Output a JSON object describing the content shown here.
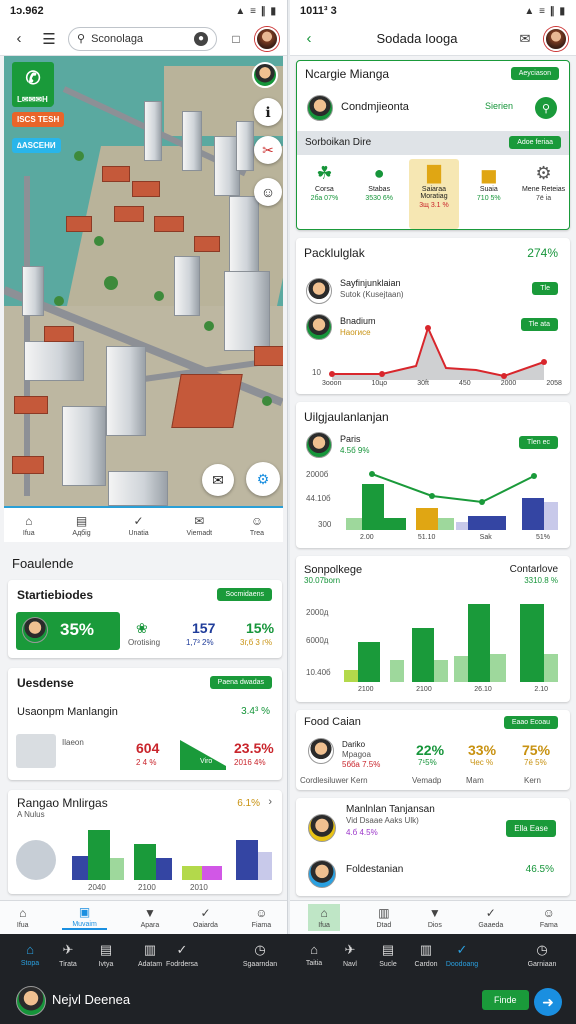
{
  "left": {
    "status": {
      "time": "1ɔ.962",
      "icons": "▲ ≡ ∥ ▮"
    },
    "search": {
      "placeholder": "Sconolaga"
    },
    "map": {
      "chip1": "L✉✉✉H",
      "chip2": "ISCS TESH",
      "chip3": "∆ASCEHИ",
      "tabs": [
        {
          "icon": "home-icon",
          "glyph": "⌂",
          "label": "Ifua"
        },
        {
          "icon": "grid-icon",
          "glyph": "▤",
          "label": "Aдбig"
        },
        {
          "icon": "check-icon",
          "glyph": "✓",
          "label": "Unatia"
        },
        {
          "icon": "chat-icon",
          "glyph": "✉",
          "label": "Viemadt"
        },
        {
          "icon": "person-icon",
          "glyph": "☺",
          "label": "Trea"
        }
      ]
    },
    "section_title": "Foaulende",
    "card1": {
      "title": "Startiebiodes",
      "btn": "Socmidaens",
      "pct": "35%",
      "item2": "Orotising",
      "v1": "157",
      "v1sub": "1,7³ 2%",
      "v2": "15%",
      "v2sub": "3г,б 3 г%"
    },
    "card2": {
      "title": "Uesdense",
      "btn": "Paena dwadas",
      "subtitle": "Usaonpm Manlangin",
      "right": "3.4³ %",
      "row_label": "Ilaeon",
      "row_sub": "Anh­­­­",
      "v1": "604",
      "v1sub": "2 4 %",
      "ramp_label": "Viro",
      "v2": "23.5%",
      "v2sub": "2016 4%"
    },
    "card3": {
      "title": "Rangao Mnlirgas",
      "subtitle": "A Nulus",
      "pct": "6.1%",
      "xticks": [
        "2040",
        "2100",
        "2010"
      ]
    },
    "bottom_tabs": [
      {
        "icon": "home-icon",
        "glyph": "⌂",
        "label": "Ifua"
      },
      {
        "icon": "grid-icon",
        "glyph": "▣",
        "label": "Muvaim"
      },
      {
        "icon": "shield-icon",
        "glyph": "▼",
        "label": "Apara"
      },
      {
        "icon": "check-icon",
        "glyph": "✓",
        "label": "Oaiarda"
      },
      {
        "icon": "person-icon",
        "glyph": "☺",
        "label": "Fiama"
      }
    ]
  },
  "right": {
    "status": {
      "time": "1011³ 3",
      "icons": "▲ ≡ ∥ ▮"
    },
    "title": "Sodada Iooga",
    "card1": {
      "title": "Ncargie Mianga",
      "btn": "Aeycіason",
      "name": "Condmjieonta",
      "badge": "Sierien",
      "band": "Sorboikan Dire",
      "band_btn": "Adoe feriaa",
      "categories": [
        {
          "icon": "leaf-icon",
          "name": "Corsa",
          "val": "2ба 07%",
          "glyph": "☘"
        },
        {
          "icon": "apple-icon",
          "name": "Stabas",
          "val": "3530 6%",
          "glyph": "●"
        },
        {
          "icon": "bars-icon",
          "name": "Saiaraa Moratiag",
          "val": "3щ 3.1 %",
          "glyph": "▇"
        },
        {
          "icon": "bars-icon",
          "name": "Suaia",
          "val": "710 5%",
          "glyph": "▅"
        },
        {
          "icon": "gear-icon",
          "name": "Mene Reteias",
          "val": "7ё іа",
          "glyph": "⚙"
        }
      ]
    },
    "card2": {
      "title": "Packlulglak",
      "pct": "274%",
      "row1": {
        "name": "Sayfinjunklaian",
        "sub": "Sutok (Kusejtaan)",
        "btn": "Tle"
      },
      "row2": {
        "name": "Bnadium",
        "sub": "Haoгисе",
        "btn": "Tle ata"
      },
      "xticks": [
        "3ooon",
        "10цo",
        "30ft",
        "450",
        "2000",
        "2058"
      ],
      "ylabel": "10"
    },
    "card3": {
      "title": "Uilgjaulanlanjan",
      "item": "Paris",
      "item_sub": "4.5б 9%",
      "btn": "Tlen ес",
      "y1": "2000б",
      "y2": "44.10б",
      "y3": "300",
      "xticks": [
        "2.00",
        "51.10",
        "Sak",
        "51%"
      ]
    },
    "card4": {
      "title": "Sonpolkege",
      "subtitle": "30.07born",
      "right": "Contarlove",
      "right_sub": "3310.8 %",
      "y1": "2000д",
      "y2": "6000д",
      "y3": "10.40б",
      "xticks": [
        "2100",
        "2100",
        "26.10",
        "2.10"
      ]
    },
    "card5": {
      "title": "Food Caian",
      "btn": "Eaao Ecoau",
      "person": "Dariko",
      "person_sub1": "Mpagoa",
      "person_sub2": "5бба 7.5%",
      "v1": "22%",
      "v1sub": "7¹5%",
      "v2": "33%",
      "v2sub": "Чес %",
      "v3": "75%",
      "v3sub": "7ё 5%",
      "foot": [
        "Cordlesiluwer Kern",
        "Vemadp",
        "Mam",
        "Kern"
      ]
    },
    "card6": {
      "row1": {
        "name": "Manlnlan Tanjansan",
        "sub": "Vid Dsaae Aaks Ulk)",
        "val": "4.б 4.5%",
        "btn": "Ella Ease"
      },
      "row2": {
        "name": "Foldestanian",
        "val": "46.5%"
      }
    },
    "bottom_tabs": [
      {
        "icon": "home-icon",
        "glyph": "⌂",
        "label": "Ifua"
      },
      {
        "icon": "doc-icon",
        "glyph": "▥",
        "label": "Dtad"
      },
      {
        "icon": "shield-icon",
        "glyph": "▼",
        "label": "Dios"
      },
      {
        "icon": "check-icon",
        "glyph": "✓",
        "label": "Gaaeda"
      },
      {
        "icon": "person-icon",
        "glyph": "☺",
        "label": "Fama"
      }
    ]
  },
  "navbar": {
    "items": [
      {
        "icon": "home-icon",
        "glyph": "⌂",
        "label": "Stopa"
      },
      {
        "icon": "plane-icon",
        "glyph": "✈",
        "label": "Tirata"
      },
      {
        "icon": "grid-icon",
        "glyph": "▤",
        "label": "Ivtya"
      },
      {
        "icon": "doc-icon",
        "glyph": "▥",
        "label": "Adatam"
      },
      {
        "icon": "check-icon",
        "glyph": "✓",
        "label": "Fodrdersa"
      },
      {
        "icon": "clock-icon",
        "glyph": "◷",
        "label": "Sgaarndan"
      },
      {
        "icon": "home-icon",
        "glyph": "⌂",
        "label": "Taitia"
      },
      {
        "icon": "plane-icon",
        "glyph": "✈",
        "label": "Navl"
      },
      {
        "icon": "grid-icon",
        "glyph": "▤",
        "label": "Sucle"
      },
      {
        "icon": "doc-icon",
        "glyph": "▥",
        "label": "Cardon"
      },
      {
        "icon": "check-icon",
        "glyph": "✓",
        "label": "Doodoang"
      },
      {
        "icon": "clock-icon",
        "glyph": "◷",
        "label": "Garniaan"
      }
    ],
    "user_name": "Nejvl Deenea",
    "action_btn": "Finde",
    "colors": {
      "accent": "#1a9a3a",
      "chat": "#1a8fe0"
    }
  }
}
